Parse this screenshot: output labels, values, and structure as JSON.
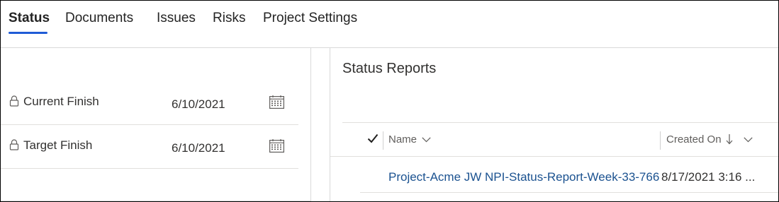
{
  "tabs": [
    {
      "label": "Status",
      "active": true
    },
    {
      "label": "Documents",
      "active": false
    },
    {
      "label": "Issues",
      "active": false
    },
    {
      "label": "Risks",
      "active": false
    },
    {
      "label": "Project Settings",
      "active": false
    }
  ],
  "dates": {
    "current_finish": {
      "label": "Current Finish",
      "value": "6/10/2021"
    },
    "target_finish": {
      "label": "Target Finish",
      "value": "6/10/2021"
    }
  },
  "status_reports": {
    "title": "Status Reports",
    "columns": {
      "name": "Name",
      "created_on": "Created On"
    },
    "rows": [
      {
        "name": "Project-Acme JW NPI-Status-Report-Week-33-766",
        "created_on": "8/17/2021 3:16 ..."
      }
    ]
  },
  "colors": {
    "accent": "#1f5bd6",
    "link": "#1b5290"
  },
  "icons": [
    "lock-icon",
    "calendar-icon",
    "checkmark-icon",
    "chevron-down-icon",
    "sort-descending-icon"
  ]
}
